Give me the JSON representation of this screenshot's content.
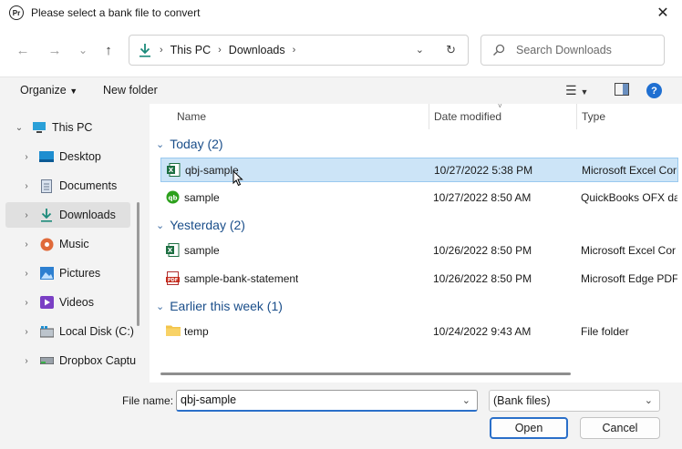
{
  "window": {
    "app_icon": "Pr",
    "title": "Please select a bank file to convert",
    "close": "✕"
  },
  "nav": {
    "back": "←",
    "forward": "→",
    "recent": "⌄",
    "up": "↑",
    "breadcrumbs": [
      "This PC",
      "Downloads"
    ],
    "search_placeholder": "Search Downloads"
  },
  "toolbar": {
    "organize": "Organize",
    "new_folder": "New folder"
  },
  "tree": [
    {
      "label": "This PC",
      "icon": "pc-icon",
      "expanded": true
    },
    {
      "label": "Desktop",
      "icon": "desktop-icon"
    },
    {
      "label": "Documents",
      "icon": "documents-icon"
    },
    {
      "label": "Downloads",
      "icon": "downloads-icon",
      "selected": true
    },
    {
      "label": "Music",
      "icon": "music-icon"
    },
    {
      "label": "Pictures",
      "icon": "pictures-icon"
    },
    {
      "label": "Videos",
      "icon": "videos-icon"
    },
    {
      "label": "Local Disk (C:)",
      "icon": "disk-icon"
    },
    {
      "label": "Dropbox Captu",
      "icon": "drive-icon"
    }
  ],
  "columns": {
    "name": "Name",
    "date": "Date modified",
    "type": "Type"
  },
  "groups": [
    {
      "label": "Today (2)",
      "files": [
        {
          "name": "qbj-sample",
          "date": "10/27/2022 5:38 PM",
          "type": "Microsoft Excel Cor",
          "icon": "excel-icon",
          "selected": true
        },
        {
          "name": "sample",
          "date": "10/27/2022 8:50 AM",
          "type": "QuickBooks OFX da",
          "icon": "quickbooks-icon"
        }
      ]
    },
    {
      "label": "Yesterday (2)",
      "files": [
        {
          "name": "sample",
          "date": "10/26/2022 8:50 PM",
          "type": "Microsoft Excel Cor",
          "icon": "excel-icon"
        },
        {
          "name": "sample-bank-statement",
          "date": "10/26/2022 8:50 PM",
          "type": "Microsoft Edge PDF",
          "icon": "pdf-icon"
        }
      ]
    },
    {
      "label": "Earlier this week (1)",
      "files": [
        {
          "name": "temp",
          "date": "10/24/2022 9:43 AM",
          "type": "File folder",
          "icon": "folder-icon"
        }
      ]
    }
  ],
  "bottom": {
    "file_name_label": "File name:",
    "file_name_value": "qbj-sample",
    "file_type": "(Bank files)",
    "open": "Open",
    "cancel": "Cancel"
  }
}
